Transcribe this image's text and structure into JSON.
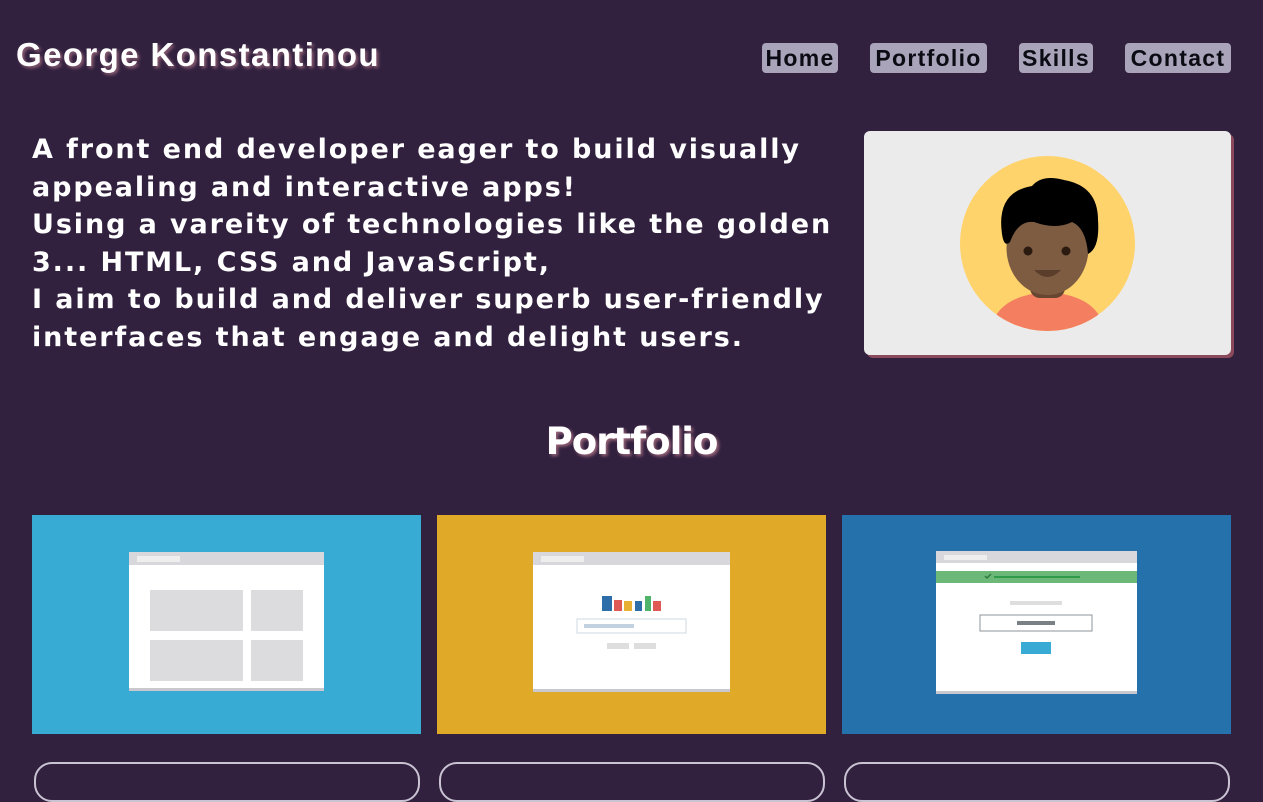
{
  "header": {
    "site_title": "George Konstantinou",
    "nav": {
      "home": "Home",
      "portfolio": "Portfolio",
      "skills": "Skills",
      "contact": "Contact"
    }
  },
  "intro": {
    "lines": [
      "A front end developer eager to build visually",
      "appealing and interactive apps!",
      "Using a vareity of technologies like the golden",
      "3... HTML, CSS and JavaScript,",
      "I aim to build and deliver superb user-friendly",
      "interfaces that engage and delight users."
    ]
  },
  "profile": {
    "icon": "avatar-icon",
    "colors": {
      "card": "#ecebec",
      "circle": "#ffd36b",
      "skin": "#7d5c42",
      "hair": "#000000",
      "shirt": "#f47e60"
    }
  },
  "portfolio": {
    "title": "Portfolio",
    "projects": [
      {
        "thumbnail": "grid-layout-icon",
        "background": "#37abd3"
      },
      {
        "thumbnail": "bar-chart-search-icon",
        "background": "#e0aa28"
      },
      {
        "thumbnail": "login-form-icon",
        "background": "#2571ab"
      }
    ]
  },
  "colors": {
    "page_background": "#31213f",
    "nav_button": "#a9a4ba"
  }
}
